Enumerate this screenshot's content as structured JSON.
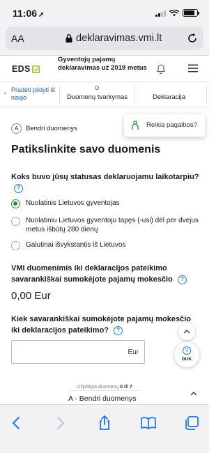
{
  "status_bar": {
    "time": "11:06",
    "location_arrow": "➚",
    "signal_bars_lit": 2,
    "signal_bars_total": 4,
    "battery_level": 0.85
  },
  "browser": {
    "aa_label": "AA",
    "url": "deklaravimas.vmi.lt"
  },
  "header": {
    "logo": "EDS",
    "title": "Gyventojų pajamų deklaravimas už 2019 metus"
  },
  "steps": {
    "back_label": "Pradėti pildyti iš naujo",
    "step_one": "Duomenų tvarkymas",
    "step_two": "Deklaracija"
  },
  "help": {
    "label": "Reikia pagalbos?"
  },
  "section": {
    "letter": "A",
    "name": "Bendri duomenys"
  },
  "page_title": "Patikslinkite savo duomenis",
  "status_question": {
    "text": "Koks buvo jūsų statusas deklaruojamu laikotarpiu?",
    "info": "?"
  },
  "status_options": [
    {
      "label": "Nuolatinis Lietuvos gyventojas",
      "checked": true
    },
    {
      "label": "Nuolatiniu Lietuvos gyventoju tapęs (-usi) dėl per dvejus metus išbūtų 280 dienų",
      "checked": false
    },
    {
      "label": "Galutinai išvykstantis iš Lietuvos",
      "checked": false
    }
  ],
  "vmi_info": {
    "text": "VMI duomenimis iki deklaracijos pateikimo savarankiškai sumokėjote pajamų mokesčio",
    "info": "?",
    "amount": "0,00 Eur"
  },
  "paid_question": {
    "text": "Kiek savarankiškai sumokėjote pajamų mokesčio iki deklaracijos pateikimo?",
    "info": "?",
    "value": "",
    "suffix": "Eur"
  },
  "floating": {
    "up": "^",
    "duk_icon": "?",
    "duk_label": "DUK"
  },
  "progress": {
    "prefix": "Užpildyta duomenų",
    "done": "0",
    "separator": "iš",
    "total": "7",
    "fraction": 0,
    "current": "A  -  Bendri duomenys",
    "collapse": "^"
  },
  "toolbar": {
    "icons": [
      "back-arrow-icon",
      "forward-arrow-icon",
      "share-icon",
      "bookmarks-icon",
      "tabs-icon"
    ]
  },
  "colors": {
    "accent_green": "#2e8b3a",
    "link_blue": "#1f5ea8",
    "info_blue": "#1f7bd6",
    "ios_blue": "#1a73e8"
  }
}
